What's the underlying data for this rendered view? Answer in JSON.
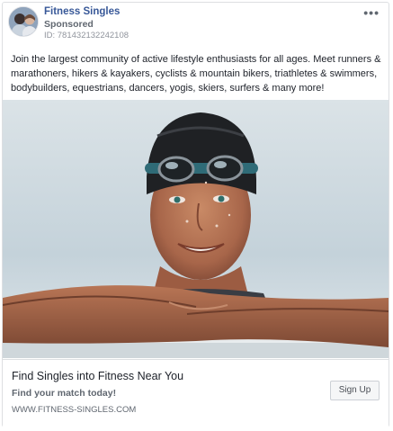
{
  "post": {
    "page_name": "Fitness Singles",
    "sponsored_label": "Sponsored",
    "ad_id": "ID: 781432132242108",
    "more_label": "•••",
    "body_text": "Join the largest community of active lifestyle enthusiasts for all ages. Meet runners & marathoners, hikers & kayakers, cyclists & mountain bikers, triathletes & swimmers, bodybuilders, equestrians, dancers, yogis, skiers, surfers & many more!"
  },
  "image": {
    "icon": "swimmer-photo"
  },
  "cta": {
    "headline": "Find Singles into Fitness Near You",
    "subline": "Find your match today!",
    "url": "WWW.FITNESS-SINGLES.COM",
    "button_label": "Sign Up"
  },
  "colors": {
    "link": "#385898",
    "muted": "#606770",
    "border": "#dddfe2"
  }
}
